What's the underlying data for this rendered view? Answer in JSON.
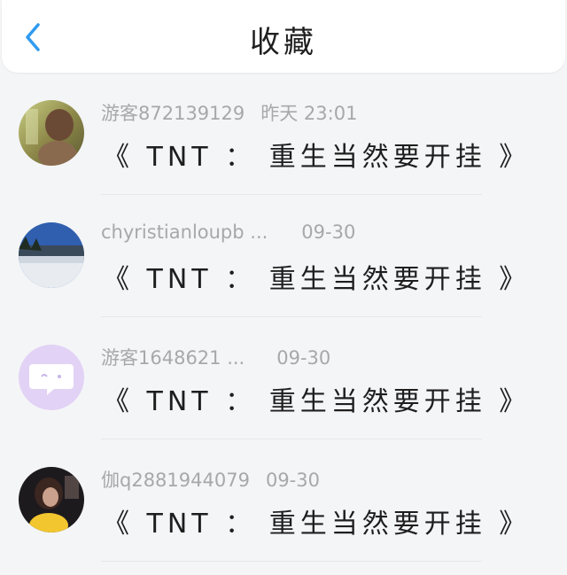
{
  "header": {
    "title": "收藏",
    "back_icon": "chevron-left-icon",
    "accent_color": "#2f9bf0"
  },
  "items": [
    {
      "user": "游客872139129",
      "time": "昨天 23:01",
      "text": "《 TNT ： 重生当然要开挂 》",
      "avatar": "avatar-photo-woman-outdoor"
    },
    {
      "user": "chyristianloupb ...",
      "time": "09-30",
      "text": "《 TNT ： 重生当然要开挂 》",
      "avatar": "avatar-photo-snowy-landscape"
    },
    {
      "user": "游客1648621 ...",
      "time": "09-30",
      "text": "《 TNT ： 重生当然要开挂 》",
      "avatar": "chat-bubble-icon"
    },
    {
      "user": "伽q2881944079",
      "time": "09-30",
      "text": "《 TNT ： 重生当然要开挂 》",
      "avatar": "avatar-photo-woman-indoor"
    }
  ]
}
